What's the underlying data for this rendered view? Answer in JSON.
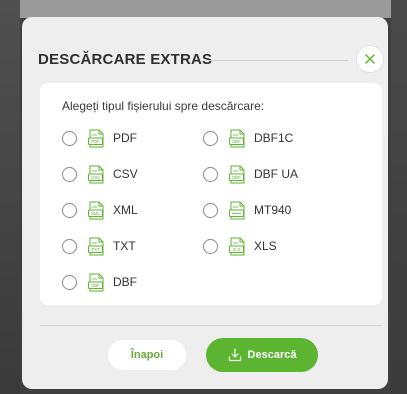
{
  "modal": {
    "title": "DESCĂRCARE EXTRAS",
    "prompt": "Alegeți tipul fișierului spre descărcare:",
    "close_icon": "close-icon",
    "file_icon_color": "#5bb531"
  },
  "options": {
    "left": [
      {
        "label": "PDF",
        "icon_text": "PDF"
      },
      {
        "label": "CSV",
        "icon_text": "CSV"
      },
      {
        "label": "XML",
        "icon_text": "XML"
      },
      {
        "label": "TXT",
        "icon_text": "TXT"
      },
      {
        "label": "DBF",
        "icon_text": "DBF"
      }
    ],
    "right": [
      {
        "label": "DBF1C",
        "icon_text": "DBF"
      },
      {
        "label": "DBF UA",
        "icon_text": "DBF"
      },
      {
        "label": "MT940",
        "icon_text": ""
      },
      {
        "label": "XLS",
        "icon_text": "XLS"
      }
    ]
  },
  "footer": {
    "back_label": "Înapoi",
    "download_label": "Descarcă",
    "accent_color": "#5bb531"
  }
}
